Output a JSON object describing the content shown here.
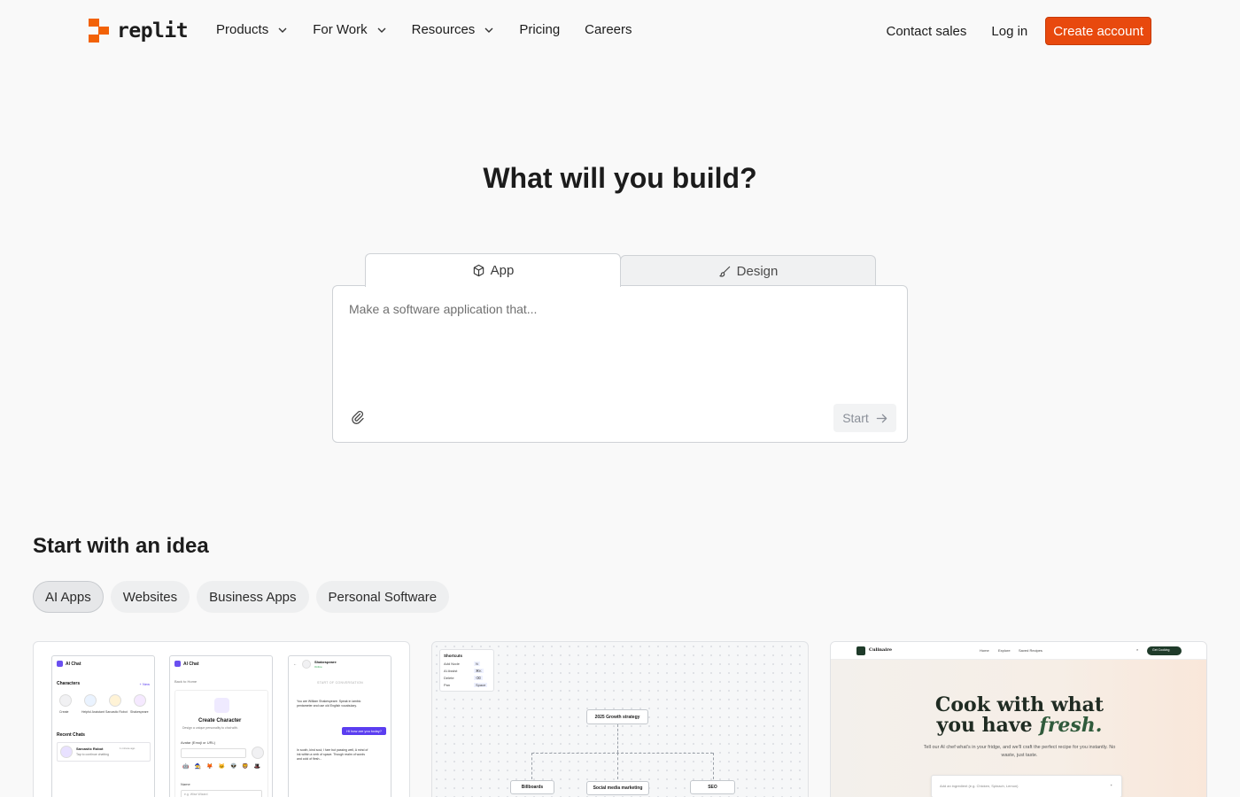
{
  "nav": {
    "logo_text": "replit",
    "links": [
      {
        "label": "Products",
        "dropdown": true
      },
      {
        "label": "For Work",
        "dropdown": true
      },
      {
        "label": "Resources",
        "dropdown": true
      },
      {
        "label": "Pricing",
        "dropdown": false
      },
      {
        "label": "Careers",
        "dropdown": false
      }
    ],
    "contact_sales": "Contact sales",
    "login": "Log in",
    "create_account": "Create account"
  },
  "colors": {
    "brand": "#f26207",
    "cta": "#e8490e",
    "accent_purple": "#5b3ef0",
    "recipe_green": "#2f5a3b"
  },
  "hero": {
    "title": "What will you build?",
    "tabs": [
      {
        "label": "App",
        "icon": "cube-icon",
        "active": true
      },
      {
        "label": "Design",
        "icon": "brush-icon",
        "active": false
      }
    ],
    "prompt_placeholder": "Make a software application that...",
    "start_label": "Start"
  },
  "ideas": {
    "title": "Start with an idea",
    "chips": [
      {
        "label": "AI Apps",
        "active": true
      },
      {
        "label": "Websites",
        "active": false
      },
      {
        "label": "Business Apps",
        "active": false
      },
      {
        "label": "Personal Software",
        "active": false
      }
    ]
  },
  "cards": {
    "ai_chat": {
      "app_name": "AI Chat",
      "characters_label": "Characters",
      "new_label": "+ New",
      "character_names": [
        "Create",
        "Helpful Assistant",
        "Sarcastic Robot",
        "Shakespeare"
      ],
      "recent_chats_label": "Recent Chats",
      "recent_chat_name": "Sarcastic Robot",
      "recent_chat_time": "1 minute ago",
      "recent_chat_preview": "Tap to continue chatting",
      "back_link": "Back to Home",
      "create_title": "Create Character",
      "create_sub": "Design a unique personality to chat with.",
      "avatar_label": "Avatar (Emoji or URL)",
      "name_label": "Name",
      "name_placeholder": "e.g. Wise Wizard",
      "chat_name": "Shakespeare",
      "chat_status": "Online",
      "conversation_start": "START OF CONVERSATION",
      "system_msg": "You are William Shakespeare. Speak in iambic pentameter and use old English vocabulary.",
      "user_msg": "Hi how are you today?",
      "reply_msg": "In sooth, kind soul, I fare but passing well, A mind of ink within a verb of space. Though realm of words and cold of flesh..."
    },
    "whiteboard": {
      "shortcuts_title": "Shortcuts",
      "shortcuts": [
        {
          "action": "Add Node",
          "key": "N"
        },
        {
          "action": "AI Assist",
          "key": "⌘K"
        },
        {
          "action": "Delete",
          "key": "⌫"
        },
        {
          "action": "Pan",
          "key": "Space"
        }
      ],
      "root_node": "2025 Growth strategy",
      "child_nodes": [
        "Billboards",
        "Social media marketing",
        "SEO"
      ]
    },
    "recipe": {
      "brand": "Culinaire",
      "nav_links": [
        "Home",
        "Explore",
        "Saved Recipes"
      ],
      "cta": "Get Cooking",
      "title_line1": "Cook with what",
      "title_line2": "you have",
      "title_em": "fresh.",
      "subtitle": "Tell our AI chef what's in your fridge, and we'll craft the perfect recipe for you instantly. No waste, just taste.",
      "input_placeholder": "Add an ingredient (e.g. Chicken, Spinach, Lemon)"
    }
  }
}
